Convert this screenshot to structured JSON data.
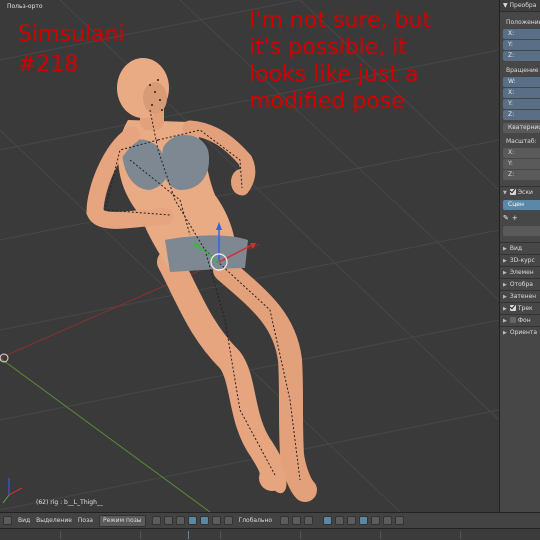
{
  "viewport": {
    "view_label": "Польз-орто",
    "status": "(62) rig : b__L_Thigh__"
  },
  "overlay": {
    "left_line1": "Simsulani",
    "left_line2": "#218",
    "right_line1": "I'm not sure, but",
    "right_line2": "it's possible, it",
    "right_line3": "looks like just a",
    "right_line4": "modified pose"
  },
  "props": {
    "transform_header": "▼ Преобра",
    "location_label": "Положение",
    "loc_x": "X:",
    "loc_y": "Y:",
    "loc_z": "Z:",
    "rotation_label": "Вращение",
    "rot_w": "W:",
    "rot_x": "X:",
    "rot_y": "Y:",
    "rot_z": "Z:",
    "quat_label": "Кватернио",
    "scale_label": "Масштаб:",
    "scale_x": "X:",
    "scale_y": "Y:",
    "scale_z": "Z:",
    "sketch_label": "Эски",
    "scene_button": "Сцен",
    "tool_plus": "+",
    "sections": [
      "Вид",
      "3D-курс",
      "Элемен",
      "Отобра",
      "Затенен"
    ],
    "track_label": "Трек",
    "background_label": "Фон",
    "orient_label": "Ориента"
  },
  "footer": {
    "view": "Вид",
    "select": "Выделение",
    "pose": "Поза",
    "mode": "Режим позы",
    "orientation": "Глобально"
  },
  "colors": {
    "overlay_text": "#d30000",
    "viewport_bg": "#3a3a3a",
    "field_blue": "#5a6f86",
    "accent_blue": "#5a89a8"
  }
}
